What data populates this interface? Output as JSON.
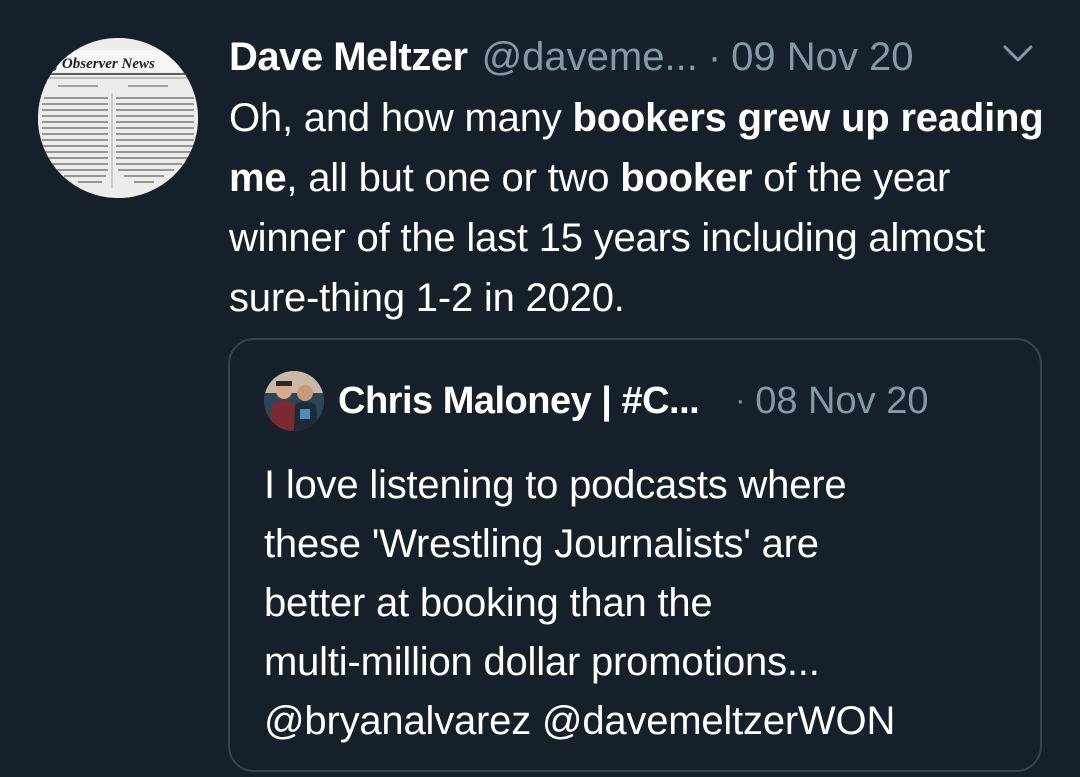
{
  "tweet": {
    "author_name": "Dave Meltzer",
    "author_handle": "@daveme...",
    "separator": "·",
    "date": "09 Nov 20",
    "avatar_text": "ling Observer News",
    "text_segments": [
      {
        "text": "Oh, and how many ",
        "bold": false
      },
      {
        "text": "bookers grew up reading me",
        "bold": true
      },
      {
        "text": ", all but one or two ",
        "bold": false
      },
      {
        "text": "booker",
        "bold": true
      },
      {
        "text": " of the year winner of the last 15 years including almost sure-thing  1-2 in 2020.",
        "bold": false
      }
    ],
    "menu_icon": "chevron-down-icon"
  },
  "quoted_tweet": {
    "author_name": "Chris Maloney | #C...",
    "separator": "·",
    "date": "08 Nov 20",
    "text_lines": [
      "I love listening to podcasts where",
      "these 'Wrestling Journalists' are",
      "better at booking than the",
      "multi-million dollar promotions...",
      "@bryanalvarez @davemeltzerWON"
    ]
  },
  "colors": {
    "background": "#15202b",
    "text": "#ffffff",
    "secondary_text": "#8899a6",
    "border": "#38444d"
  }
}
